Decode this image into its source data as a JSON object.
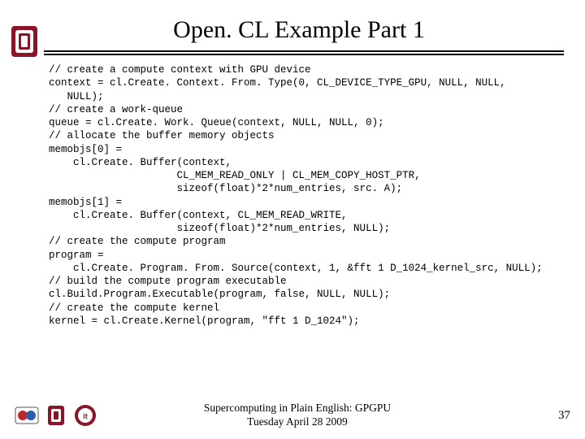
{
  "title": "Open. CL Example Part 1",
  "code_lines": [
    "// create a compute context with GPU device",
    "context = cl.Create. Context. From. Type(0, CL_DEVICE_TYPE_GPU, NULL, NULL,",
    "   NULL);",
    "// create a work-queue",
    "queue = cl.Create. Work. Queue(context, NULL, NULL, 0);",
    "// allocate the buffer memory objects",
    "memobjs[0] =",
    "    cl.Create. Buffer(context,",
    "                     CL_MEM_READ_ONLY | CL_MEM_COPY_HOST_PTR,",
    "                     sizeof(float)*2*num_entries, src. A);",
    "memobjs[1] =",
    "    cl.Create. Buffer(context, CL_MEM_READ_WRITE,",
    "                     sizeof(float)*2*num_entries, NULL);",
    "// create the compute program",
    "program =",
    "    cl.Create. Program. From. Source(context, 1, &fft 1 D_1024_kernel_src, NULL);",
    "// build the compute program executable",
    "cl.Build.Program.Executable(program, false, NULL, NULL);",
    "// create the compute kernel",
    "kernel = cl.Create.Kernel(program, \"fft 1 D_1024\");"
  ],
  "footer": {
    "line1": "Supercomputing in Plain English: GPGPU",
    "line2": "Tuesday April 28 2009"
  },
  "slide_number": "37"
}
